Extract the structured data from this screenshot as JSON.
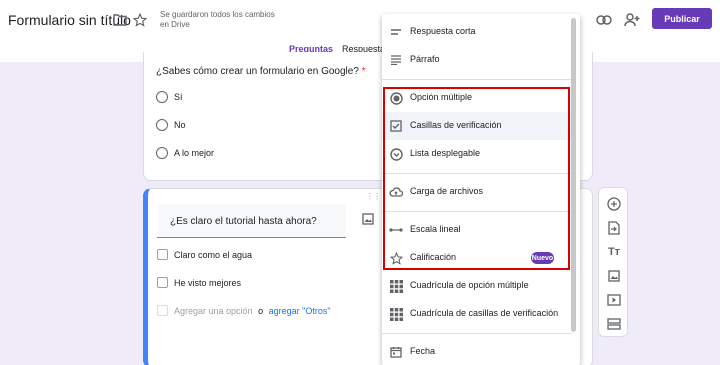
{
  "header": {
    "title": "Formulario sin título",
    "save_status": "Se guardaron todos los cambios en Drive",
    "publish_label": "Publicar",
    "accent_color": "#673ab7"
  },
  "tabs": [
    {
      "label": "Preguntas"
    },
    {
      "label": "Respuesta"
    }
  ],
  "questions": [
    {
      "title": "¿Sabes cómo crear un formulario en Google?",
      "required_mark": "*",
      "options": [
        "Sí",
        "No",
        "A lo mejor"
      ]
    },
    {
      "title": "¿Es claro el tutorial hasta ahora?",
      "options": [
        "Claro como el agua",
        "He visto mejores"
      ],
      "add_option": "Agregar una opción",
      "or": "o",
      "add_other": "agregar \"Otros\""
    }
  ],
  "menu": {
    "items": [
      {
        "label": "Respuesta corta",
        "icon": "short-answer-icon"
      },
      {
        "label": "Párrafo",
        "icon": "paragraph-icon"
      },
      {
        "label": "Opción múltiple",
        "icon": "radio-icon"
      },
      {
        "label": "Casillas de verificación",
        "icon": "checkbox-icon"
      },
      {
        "label": "Lista desplegable",
        "icon": "dropdown-icon"
      },
      {
        "label": "Carga de archivos",
        "icon": "cloud-upload-icon"
      },
      {
        "label": "Escala lineal",
        "icon": "linear-scale-icon"
      },
      {
        "label": "Calificación",
        "icon": "star-icon"
      },
      {
        "label": "Cuadrícula de opción múltiple",
        "icon": "grid-icon"
      },
      {
        "label": "Cuadrícula de casillas de verificación",
        "icon": "grid-icon"
      },
      {
        "label": "Fecha",
        "icon": "calendar-icon"
      }
    ],
    "new_badge": "Nuevo"
  }
}
